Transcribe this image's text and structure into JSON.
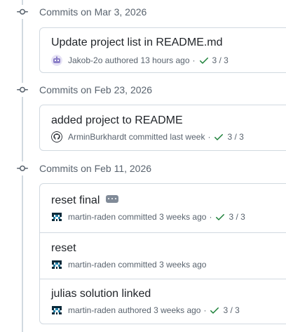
{
  "groups": [
    {
      "title": "Commits on Mar 3, 2026",
      "commits": [
        {
          "title": "Update project list in README.md",
          "author": "Jakob-2o",
          "action": "authored",
          "time": "13 hours ago",
          "separator": "·",
          "checks": "3 / 3",
          "avatar_icon": "robot-avatar-icon"
        }
      ]
    },
    {
      "title": "Commits on Feb 23, 2026",
      "commits": [
        {
          "title": "added project to README",
          "author": "ArminBurkhardt",
          "action": "committed",
          "time": "last week",
          "separator": "·",
          "checks": "3 / 3",
          "avatar_icon": "octocat-avatar-icon"
        }
      ]
    },
    {
      "title": "Commits on Feb 11, 2026",
      "commits": [
        {
          "title": "reset final",
          "author": "martin-raden",
          "action": "committed",
          "time": "3 weeks ago",
          "separator": "·",
          "checks": "3 / 3",
          "avatar_icon": "pixel-avatar-icon"
        },
        {
          "title": "reset",
          "author": "martin-raden",
          "action": "committed",
          "time": "3 weeks ago",
          "avatar_icon": "pixel-avatar-icon"
        },
        {
          "title": "julias solution linked",
          "author": "martin-raden",
          "action": "authored",
          "time": "3 weeks ago",
          "separator": "·",
          "checks": "3 / 3",
          "avatar_icon": "pixel-avatar-icon"
        }
      ]
    }
  ],
  "colors": {
    "check_green": "#1a7f37",
    "border": "#d1d9e0",
    "muted_text": "#59636e",
    "timeline_line": "#d1d9e0"
  }
}
